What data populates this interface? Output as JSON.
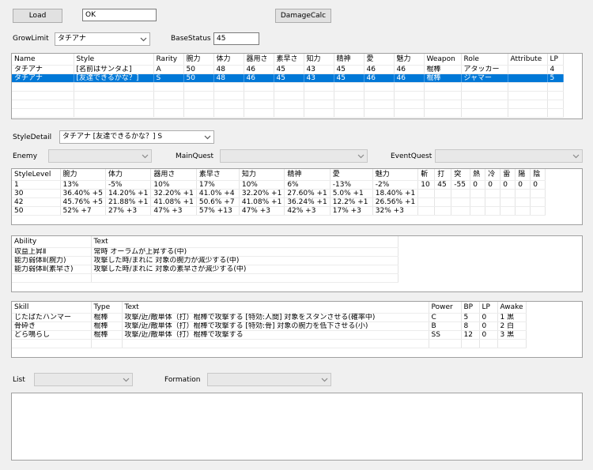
{
  "top": {
    "load_label": "Load",
    "status_value": "OK",
    "damagecalc_label": "DamageCalc",
    "growlimit_label": "GrowLimit",
    "growlimit_value": "タチアナ",
    "basestatus_label": "BaseStatus",
    "basestatus_value": "45"
  },
  "styles": {
    "headers": [
      "Name",
      "Style",
      "Rarity",
      "腕力",
      "体力",
      "器用さ",
      "素早さ",
      "知力",
      "精神",
      "愛",
      "魅力",
      "Weapon",
      "Role",
      "Attribute",
      "LP"
    ],
    "rows": [
      [
        "タチアナ",
        "[名前はサンタよ]",
        "A",
        "50",
        "48",
        "46",
        "45",
        "43",
        "45",
        "46",
        "46",
        "棍棒",
        "アタッカー",
        "",
        "4"
      ],
      [
        "タチアナ",
        "[友達できるかな？]",
        "S",
        "50",
        "48",
        "46",
        "45",
        "43",
        "45",
        "46",
        "46",
        "棍棒",
        "ジャマー",
        "",
        "5"
      ]
    ],
    "selected_row": 1
  },
  "filters": {
    "styledetail_label": "StyleDetail",
    "styledetail_value": "タチアナ [友達できるかな？] S",
    "enemy_label": "Enemy",
    "mainquest_label": "MainQuest",
    "eventquest_label": "EventQuest"
  },
  "levels": {
    "headers": [
      "StyleLevel",
      "腕力",
      "体力",
      "器用さ",
      "素早さ",
      "知力",
      "精神",
      "愛",
      "魅力",
      "斬",
      "打",
      "突",
      "熱",
      "冷",
      "雷",
      "陽",
      "陰"
    ],
    "rows": [
      [
        "1",
        "13%",
        "-5%",
        "10%",
        "17%",
        "10%",
        "6%",
        "-13%",
        "-2%",
        "10",
        "45",
        "-55",
        "0",
        "0",
        "0",
        "0",
        "0"
      ],
      [
        "30",
        "36.40% +5",
        "14.20% +1",
        "32.20% +1",
        "41.0% +4",
        "32.20% +1",
        "27.60% +1",
        "5.0% +1",
        "18.40% +1",
        "",
        "",
        "",
        "",
        "",
        "",
        "",
        ""
      ],
      [
        "42",
        "45.76% +5",
        "21.88% +1",
        "41.08% +1",
        "50.6% +7",
        "41.08% +1",
        "36.24% +1",
        "12.2% +1",
        "26.56% +1",
        "",
        "",
        "",
        "",
        "",
        "",
        "",
        ""
      ],
      [
        "50",
        "52% +7",
        "27% +3",
        "47% +3",
        "57% +13",
        "47% +3",
        "42% +3",
        "17% +3",
        "32% +3",
        "",
        "",
        "",
        "",
        "",
        "",
        "",
        ""
      ]
    ]
  },
  "abilities": {
    "headers": [
      "Ability",
      "Text"
    ],
    "rows": [
      [
        "収益上昇Ⅱ",
        "常時 オーラムが上昇する(中)"
      ],
      [
        "能力弱体Ⅱ(腕力)",
        "攻撃した時/まれに 対象の腕力が減少する(中)"
      ],
      [
        "能力弱体Ⅱ(素早さ)",
        "攻撃した時/まれに 対象の素早さが減少する(中)"
      ]
    ]
  },
  "skills": {
    "headers": [
      "Skill",
      "Type",
      "Text",
      "Power",
      "BP",
      "LP",
      "Awake"
    ],
    "rows": [
      [
        "じたばたハンマー",
        "棍棒",
        "攻撃/近/敵単体（打）棍棒で攻撃する [特効:人間] 対象をスタンさせる(確率中)",
        "C",
        "5",
        "0",
        "1 黒"
      ],
      [
        "骨砕き",
        "棍棒",
        "攻撃/近/敵単体（打）棍棒で攻撃する [特効:骨] 対象の腕力を低下させる(小)",
        "B",
        "8",
        "0",
        "2 白"
      ],
      [
        "どら鳴らし",
        "棍棒",
        "攻撃/近/敵単体（打）棍棒で攻撃する",
        "SS",
        "12",
        "0",
        "3 黒"
      ]
    ]
  },
  "bottom": {
    "list_label": "List",
    "formation_label": "Formation"
  },
  "icons": {
    "dropdown": "chevron-down-icon"
  }
}
